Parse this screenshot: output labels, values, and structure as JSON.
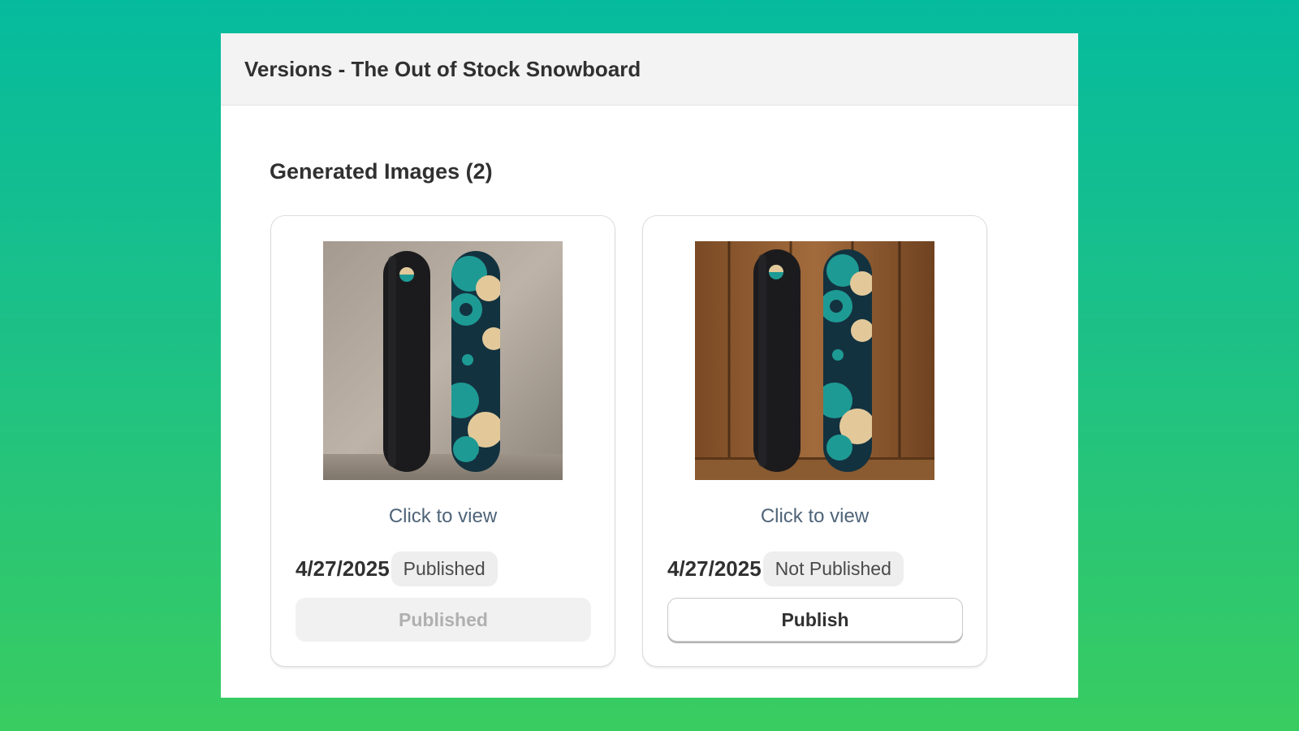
{
  "modal": {
    "title": "Versions - The Out of Stock Snowboard"
  },
  "section": {
    "title": "Generated Images (2)"
  },
  "cards": [
    {
      "thumbnail": "snowboard-concrete-wall-image",
      "view_label": "Click to view",
      "date": "4/27/2025",
      "status": "Published",
      "button_label": "Published",
      "button_enabled": false
    },
    {
      "thumbnail": "snowboard-wood-wall-image",
      "view_label": "Click to view",
      "date": "4/27/2025",
      "status": "Not Published",
      "button_label": "Publish",
      "button_enabled": true
    }
  ],
  "colors": {
    "background_top": "#05bb9e",
    "background_bottom": "#39cc60",
    "board_teal": "#1e9a94",
    "board_navy": "#13323f",
    "board_cream": "#e3c99a"
  }
}
